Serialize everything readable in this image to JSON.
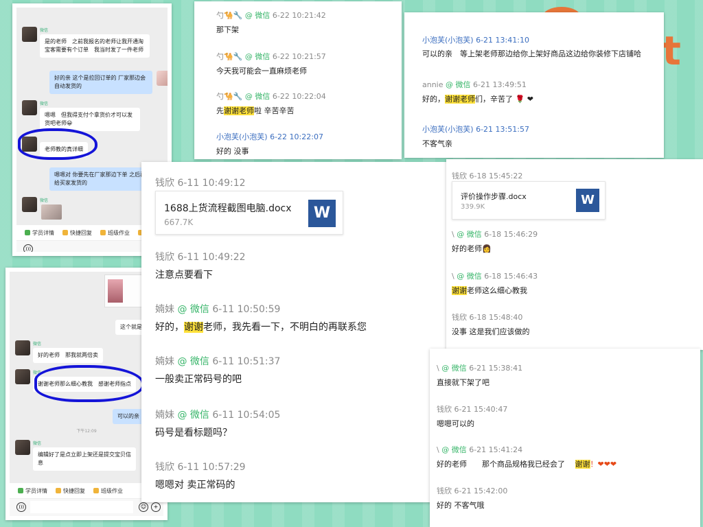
{
  "phone1": {
    "messages": [
      {
        "side": "left",
        "tag": "微信",
        "text": "是的老师　之前我报名的老师让我开通淘宝客需要有个订单　我当时发了一件老师"
      },
      {
        "side": "right",
        "text": "好的亲 这个是拉回订单的 厂家那边会自动发货的"
      },
      {
        "side": "left",
        "tag": "微信",
        "text": "嗯嗯　但我得支付个拿货价才可以发货吧老师😀"
      },
      {
        "side": "left",
        "tag": "微信",
        "text": "老师教的真详细"
      },
      {
        "side": "right",
        "text": "嗯嗯对 你要先在厂家那边下单 之后再给买家发货的"
      },
      {
        "side": "left",
        "tag": "微信",
        "text": ""
      }
    ],
    "toolbar": [
      "学员详情",
      "快捷回复",
      "班级作业",
      "◎"
    ]
  },
  "phone2": {
    "messages": [
      {
        "side": "right",
        "text": "这个就是进价"
      },
      {
        "side": "left",
        "tag": "微信",
        "text": "好的老师　那我就两倍卖"
      },
      {
        "side": "left",
        "tag": "微信",
        "text": "谢谢老师那么细心教我　感谢老师指点"
      },
      {
        "side": "right",
        "text": "可以的亲"
      },
      {
        "side": "left",
        "tag": "微信",
        "text": "编辑好了是点立即上架还是提交宝贝信息"
      }
    ],
    "time": "下午12:09",
    "toolbar": [
      "学员详情",
      "快捷回复",
      "班级作业"
    ]
  },
  "panel_a": [
    {
      "sender": "勺🐪🔧",
      "wx": "@ 微信",
      "time": "6-22 10:21:42",
      "text": "那下架"
    },
    {
      "sender": "勺🐪🔧",
      "wx": "@ 微信",
      "time": "6-22 10:21:57",
      "text": "今天我可能会一直麻烦老师"
    },
    {
      "sender": "勺🐪🔧",
      "wx": "@ 微信",
      "time": "6-22 10:22:04",
      "text_pre": "先",
      "text_hl": "谢谢老师",
      "text_post": "啦 辛苦辛苦"
    },
    {
      "sender": "小泡芙(小泡芙)",
      "wx": "",
      "time": "6-22 10:22:07",
      "text": "好的 没事"
    }
  ],
  "panel_b": [
    {
      "sender": "小泡芙(小泡芙)",
      "wx": "",
      "time": "6-21 13:41:10",
      "text": "可以的亲　等上架老师那边给你上架好商品这边给你装修下店铺哈"
    },
    {
      "sender": "annie",
      "wx": "@ 微信",
      "time": "6-21 13:49:51",
      "text_pre": "好的，",
      "text_hl": "谢谢老师",
      "text_post": "们，辛苦了 🌹 ❤"
    },
    {
      "sender": "小泡芙(小泡芙)",
      "wx": "",
      "time": "6-21 13:51:57",
      "text": "不客气亲"
    }
  ],
  "panel_c": {
    "file_header": {
      "sender": "钱欣",
      "time": "6-11 10:49:12"
    },
    "file": {
      "name": "1688上货流程截图电脑.docx",
      "size": "667.7K",
      "icon": "W"
    },
    "messages": [
      {
        "sender": "钱欣",
        "wx": "",
        "time": "6-11 10:49:22",
        "text": "注意点要看下"
      },
      {
        "sender": "婻妹",
        "wx": "@ 微信",
        "time": "6-11 10:50:59",
        "text_pre": "好的，",
        "text_hl": "谢谢",
        "text_post": "老师，我先看一下，不明白的再联系您"
      },
      {
        "sender": "婻妹",
        "wx": "@ 微信",
        "time": "6-11 10:51:37",
        "text": "一般卖正常码号的吧"
      },
      {
        "sender": "婻妹",
        "wx": "@ 微信",
        "time": "6-11 10:54:05",
        "text": "码号是看标题吗？"
      },
      {
        "sender": "钱欣",
        "wx": "",
        "time": "6-11 10:57:29",
        "text": "嗯嗯对 卖正常码的"
      }
    ]
  },
  "panel_d": {
    "file_header": {
      "sender": "钱欣",
      "time": "6-18 15:45:22"
    },
    "file": {
      "name": "评价操作步骤.docx",
      "size": "339.9K",
      "icon": "W"
    },
    "messages": [
      {
        "sender": "\\",
        "wx": "@ 微信",
        "time": "6-18 15:46:29",
        "text": "好的老师👩"
      },
      {
        "sender": "\\",
        "wx": "@ 微信",
        "time": "6-18 15:46:43",
        "text_pre": "",
        "text_hl": "谢谢",
        "text_post": "老师这么细心教我"
      },
      {
        "sender": "钱欣",
        "wx": "",
        "time": "6-18 15:48:40",
        "text": "没事 这是我们应该做的"
      }
    ]
  },
  "panel_e": [
    {
      "sender": "\\",
      "wx": "@ 微信",
      "time": "6-21 15:38:41",
      "text": "直接就下架了吧"
    },
    {
      "sender": "钱欣",
      "wx": "",
      "time": "6-21 15:40:47",
      "text": "嗯嗯可以的"
    },
    {
      "sender": "\\",
      "wx": "@ 微信",
      "time": "6-21 15:41:24",
      "text_pre": "好的老师　　那个商品规格我已经会了　 ",
      "text_hl": "谢谢",
      "text_post": "！❤❤❤"
    },
    {
      "sender": "钱欣",
      "wx": "",
      "time": "6-21 15:42:00",
      "text": "好的 不客气哦"
    }
  ],
  "colors": {
    "background": "#8fdcc1",
    "highlight": "#ffe13a",
    "word_blue": "#2b579a",
    "circle_mark": "#1414d8",
    "wechat_green": "#37b569"
  },
  "icons": [
    "word-doc-icon",
    "voice-icon",
    "emoji-icon",
    "heart-icon",
    "rose-icon"
  ]
}
